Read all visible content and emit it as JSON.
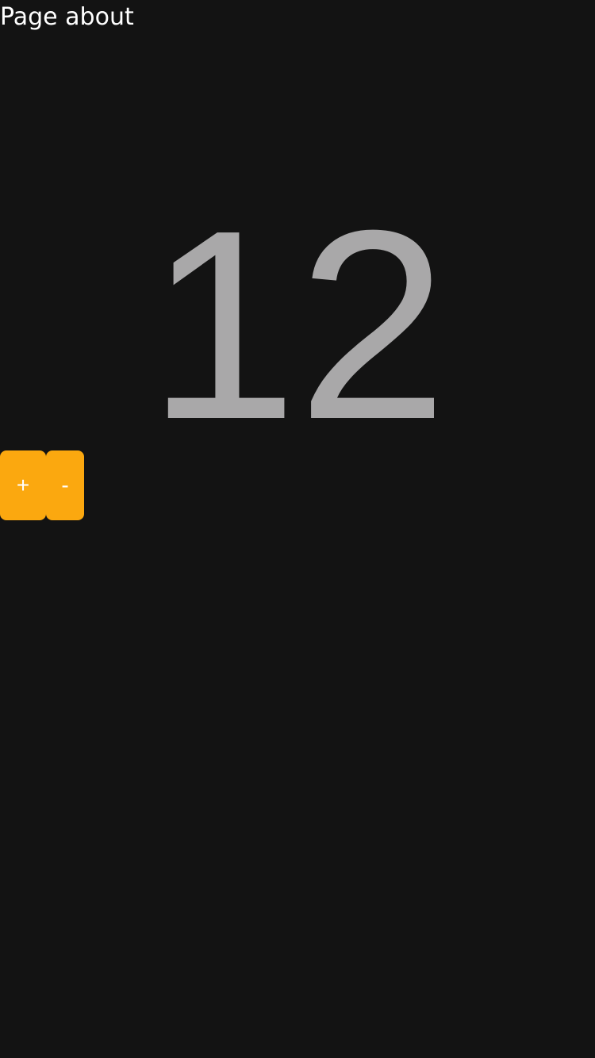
{
  "header": {
    "title": "Page about"
  },
  "counter": {
    "value": "12"
  },
  "controls": {
    "increment_label": "+",
    "decrement_label": "-"
  },
  "colors": {
    "background": "#131313",
    "accent": "#fba80f",
    "counter_text": "#a9a8a9",
    "title_text": "#ffffff"
  }
}
